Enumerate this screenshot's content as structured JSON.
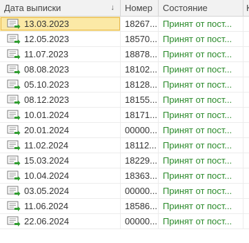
{
  "columns": {
    "date": "Дата выписки",
    "number": "Номер",
    "state": "Состояние",
    "extra": "К"
  },
  "sort_indicator": "↓",
  "rows": [
    {
      "date": "13.03.2023",
      "number": "18267...",
      "state": "Принят от пост...",
      "selected": true
    },
    {
      "date": "12.05.2023",
      "number": "18570...",
      "state": "Принят от пост..."
    },
    {
      "date": "11.07.2023",
      "number": "18878...",
      "state": "Принят от пост..."
    },
    {
      "date": "08.08.2023",
      "number": "18102...",
      "state": "Принят от пост..."
    },
    {
      "date": "05.10.2023",
      "number": "18128...",
      "state": "Принят от пост..."
    },
    {
      "date": "08.12.2023",
      "number": "18155...",
      "state": "Принят от пост..."
    },
    {
      "date": "10.01.2024",
      "number": "18171...",
      "state": "Принят от пост..."
    },
    {
      "date": "20.01.2024",
      "number": "00000...",
      "state": "Принят от пост..."
    },
    {
      "date": "11.02.2024",
      "number": "18112...",
      "state": "Принят от пост..."
    },
    {
      "date": "15.03.2024",
      "number": "18229...",
      "state": "Принят от пост..."
    },
    {
      "date": "10.04.2024",
      "number": "18363...",
      "state": "Принят от пост..."
    },
    {
      "date": "03.05.2024",
      "number": "00000...",
      "state": "Принят от пост..."
    },
    {
      "date": "11.06.2024",
      "number": "18586...",
      "state": "Принят от пост..."
    },
    {
      "date": "22.06.2024",
      "number": "00000...",
      "state": "Принят от пост..."
    }
  ],
  "row_icon": "document-received-icon",
  "colors": {
    "state_text": "#2a8a2a",
    "selected_bg": "#fbe9a6",
    "icon_arrow": "#2e9d2e"
  }
}
